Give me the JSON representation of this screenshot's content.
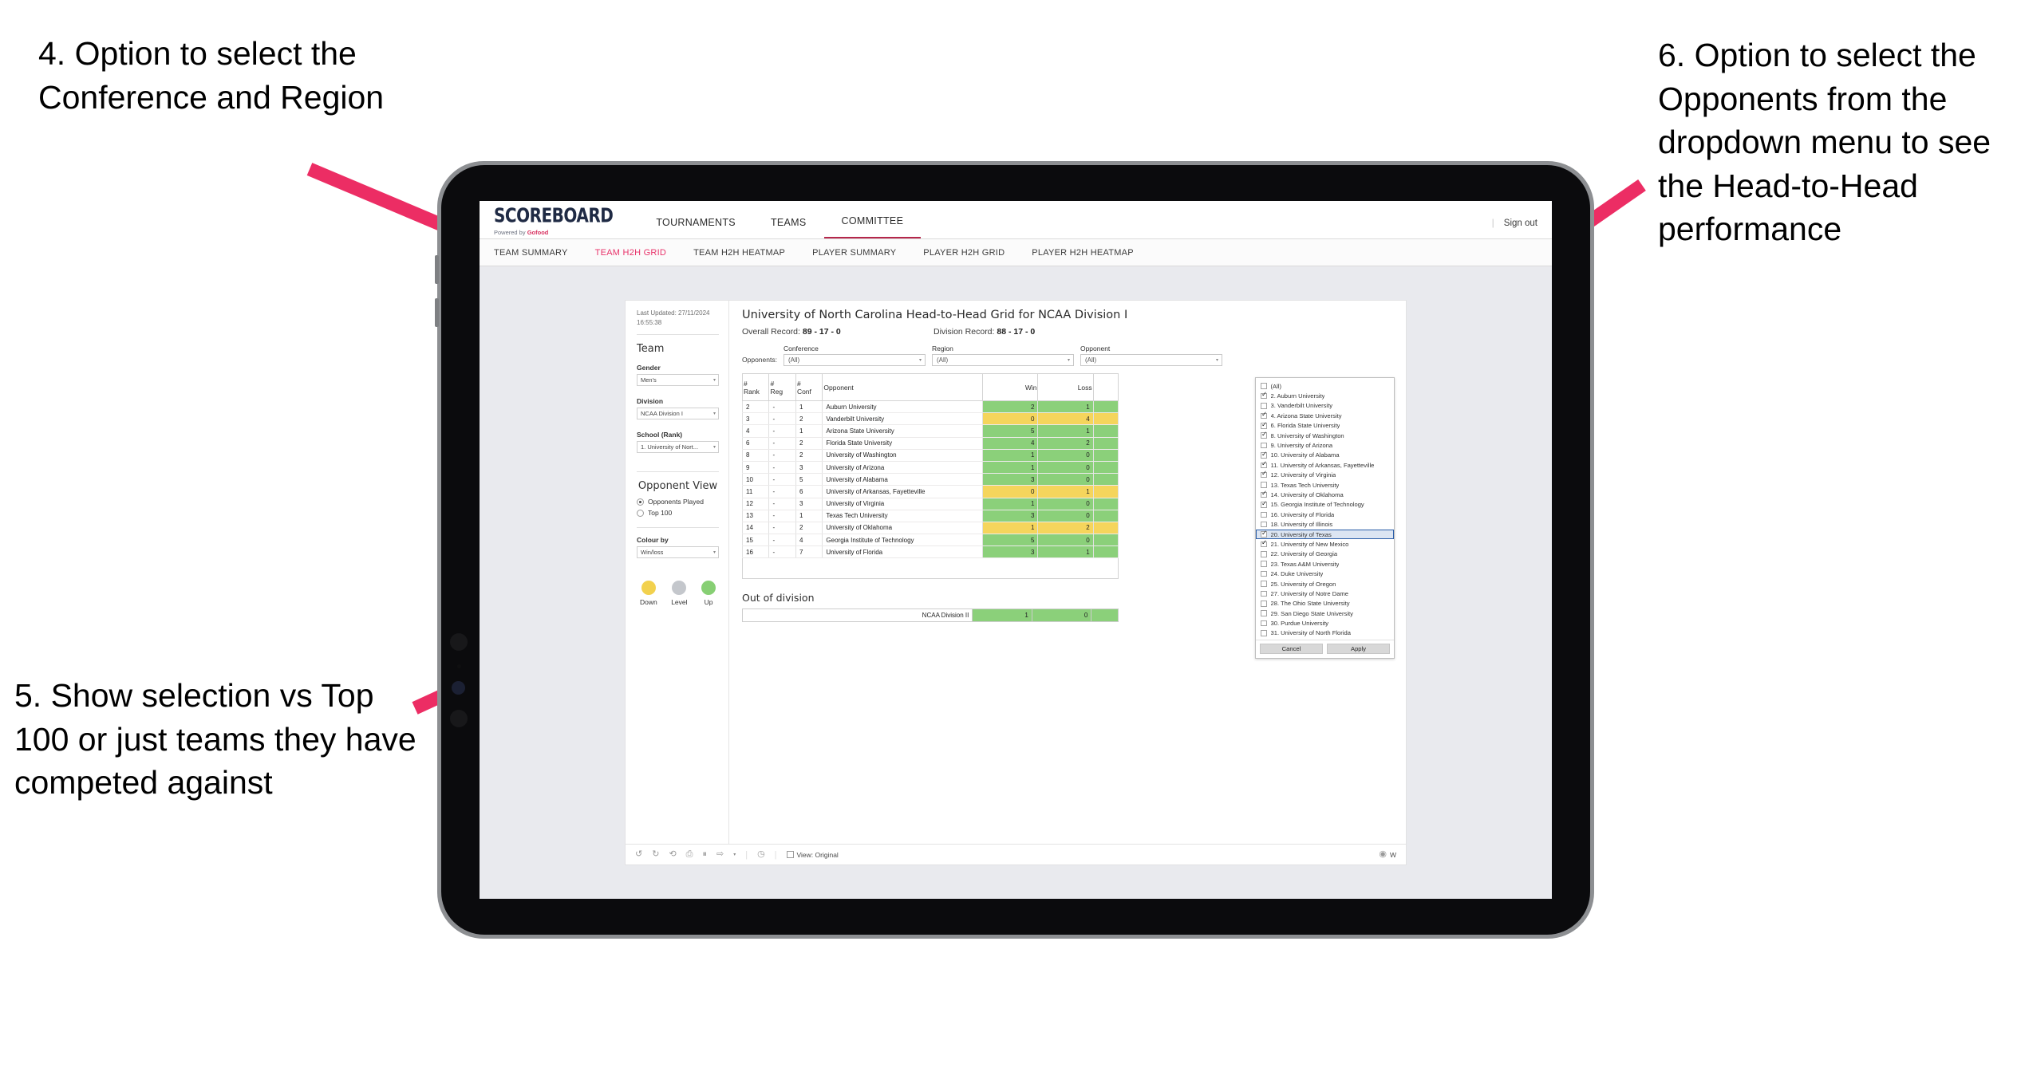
{
  "annotations": [
    {
      "id": "a4",
      "text": "4. Option to select the Conference and Region"
    },
    {
      "id": "a5",
      "text": "5. Show selection vs Top 100 or just teams they have competed against"
    },
    {
      "id": "a6",
      "text": "6. Option to select the Opponents from the dropdown menu to see the Head-to-Head performance"
    }
  ],
  "app": {
    "logo": {
      "main": "SCOREBOARD",
      "sub_prefix": "Powered by ",
      "sub_brand": "Gofood"
    },
    "topnav": [
      {
        "label": "TOURNAMENTS",
        "active": false
      },
      {
        "label": "TEAMS",
        "active": false
      },
      {
        "label": "COMMITTEE",
        "active": true
      }
    ],
    "signout": "Sign out",
    "divider": "|",
    "subnav": [
      {
        "label": "TEAM SUMMARY",
        "active": false
      },
      {
        "label": "TEAM H2H GRID",
        "active": true
      },
      {
        "label": "TEAM H2H HEATMAP",
        "active": false
      },
      {
        "label": "PLAYER SUMMARY",
        "active": false
      },
      {
        "label": "PLAYER H2H GRID",
        "active": false
      },
      {
        "label": "PLAYER H2H HEATMAP",
        "active": false
      }
    ]
  },
  "sidebar": {
    "last_updated": "Last Updated: 27/11/2024 16:55:38",
    "team_heading": "Team",
    "fields": [
      {
        "label": "Gender",
        "value": "Men's"
      },
      {
        "label": "Division",
        "value": "NCAA Division I"
      },
      {
        "label": "School (Rank)",
        "value": "1. University of Nort..."
      }
    ],
    "opponent_view_heading": "Opponent View",
    "opponent_view_options": [
      {
        "label": "Opponents Played",
        "selected": true
      },
      {
        "label": "Top 100",
        "selected": false
      }
    ],
    "colour_by": {
      "label": "Colour by",
      "value": "Win/loss"
    },
    "legend": [
      {
        "label": "Down",
        "color": "#f2d14e"
      },
      {
        "label": "Level",
        "color": "#c4c7cc"
      },
      {
        "label": "Up",
        "color": "#87cf74"
      }
    ]
  },
  "main": {
    "title": "University of North Carolina Head-to-Head Grid for NCAA Division I",
    "overall_record_label": "Overall Record:",
    "overall_record_value": "89 - 17 - 0",
    "division_record_label": "Division Record:",
    "division_record_value": "88 - 17 - 0",
    "opponents_label": "Opponents:",
    "filters": [
      {
        "label": "Conference",
        "value": "(All)"
      },
      {
        "label": "Region",
        "value": "(All)"
      },
      {
        "label": "Opponent",
        "value": "(All)"
      }
    ],
    "table": {
      "headers": [
        "# Rank",
        "# Reg",
        "# Conf",
        "Opponent",
        "Win",
        "Loss"
      ],
      "header_lines": [
        [
          "#",
          "Rank"
        ],
        [
          "#",
          "Reg"
        ],
        [
          "#",
          "Conf"
        ],
        [
          "Opponent"
        ],
        [
          "Win"
        ],
        [
          "Loss"
        ]
      ],
      "rows": [
        {
          "rank": "2",
          "reg": "-",
          "conf": "1",
          "opponent": "Auburn University",
          "win": "2",
          "loss": "1",
          "state": "up"
        },
        {
          "rank": "3",
          "reg": "-",
          "conf": "2",
          "opponent": "Vanderbilt University",
          "win": "0",
          "loss": "4",
          "state": "down"
        },
        {
          "rank": "4",
          "reg": "-",
          "conf": "1",
          "opponent": "Arizona State University",
          "win": "5",
          "loss": "1",
          "state": "up"
        },
        {
          "rank": "6",
          "reg": "-",
          "conf": "2",
          "opponent": "Florida State University",
          "win": "4",
          "loss": "2",
          "state": "up"
        },
        {
          "rank": "8",
          "reg": "-",
          "conf": "2",
          "opponent": "University of Washington",
          "win": "1",
          "loss": "0",
          "state": "up"
        },
        {
          "rank": "9",
          "reg": "-",
          "conf": "3",
          "opponent": "University of Arizona",
          "win": "1",
          "loss": "0",
          "state": "up"
        },
        {
          "rank": "10",
          "reg": "-",
          "conf": "5",
          "opponent": "University of Alabama",
          "win": "3",
          "loss": "0",
          "state": "up"
        },
        {
          "rank": "11",
          "reg": "-",
          "conf": "6",
          "opponent": "University of Arkansas, Fayetteville",
          "win": "0",
          "loss": "1",
          "state": "down"
        },
        {
          "rank": "12",
          "reg": "-",
          "conf": "3",
          "opponent": "University of Virginia",
          "win": "1",
          "loss": "0",
          "state": "up"
        },
        {
          "rank": "13",
          "reg": "-",
          "conf": "1",
          "opponent": "Texas Tech University",
          "win": "3",
          "loss": "0",
          "state": "up"
        },
        {
          "rank": "14",
          "reg": "-",
          "conf": "2",
          "opponent": "University of Oklahoma",
          "win": "1",
          "loss": "2",
          "state": "down"
        },
        {
          "rank": "15",
          "reg": "-",
          "conf": "4",
          "opponent": "Georgia Institute of Technology",
          "win": "5",
          "loss": "0",
          "state": "up"
        },
        {
          "rank": "16",
          "reg": "-",
          "conf": "7",
          "opponent": "University of Florida",
          "win": "3",
          "loss": "1",
          "state": "up"
        }
      ]
    },
    "out_of_division": {
      "title": "Out of division",
      "rows": [
        {
          "name": "NCAA Division II",
          "win": "1",
          "loss": "0",
          "state": "up"
        }
      ]
    }
  },
  "dropdown": {
    "items": [
      {
        "label": "(All)",
        "checked": false,
        "selected": false
      },
      {
        "label": "2. Auburn University",
        "checked": true,
        "selected": false
      },
      {
        "label": "3. Vanderbilt University",
        "checked": false,
        "selected": false
      },
      {
        "label": "4. Arizona State University",
        "checked": true,
        "selected": false
      },
      {
        "label": "6. Florida State University",
        "checked": true,
        "selected": false
      },
      {
        "label": "8. University of Washington",
        "checked": true,
        "selected": false
      },
      {
        "label": "9. University of Arizona",
        "checked": false,
        "selected": false
      },
      {
        "label": "10. University of Alabama",
        "checked": true,
        "selected": false
      },
      {
        "label": "11. University of Arkansas, Fayetteville",
        "checked": true,
        "selected": false
      },
      {
        "label": "12. University of Virginia",
        "checked": true,
        "selected": false
      },
      {
        "label": "13. Texas Tech University",
        "checked": false,
        "selected": false
      },
      {
        "label": "14. University of Oklahoma",
        "checked": true,
        "selected": false
      },
      {
        "label": "15. Georgia Institute of Technology",
        "checked": true,
        "selected": false
      },
      {
        "label": "16. University of Florida",
        "checked": false,
        "selected": false
      },
      {
        "label": "18. University of Illinois",
        "checked": false,
        "selected": false
      },
      {
        "label": "20. University of Texas",
        "checked": true,
        "selected": true
      },
      {
        "label": "21. University of New Mexico",
        "checked": true,
        "selected": false
      },
      {
        "label": "22. University of Georgia",
        "checked": false,
        "selected": false
      },
      {
        "label": "23. Texas A&M University",
        "checked": false,
        "selected": false
      },
      {
        "label": "24. Duke University",
        "checked": false,
        "selected": false
      },
      {
        "label": "25. University of Oregon",
        "checked": false,
        "selected": false
      },
      {
        "label": "27. University of Notre Dame",
        "checked": false,
        "selected": false
      },
      {
        "label": "28. The Ohio State University",
        "checked": false,
        "selected": false
      },
      {
        "label": "29. San Diego State University",
        "checked": false,
        "selected": false
      },
      {
        "label": "30. Purdue University",
        "checked": false,
        "selected": false
      },
      {
        "label": "31. University of North Florida",
        "checked": false,
        "selected": false
      }
    ],
    "cancel": "Cancel",
    "apply": "Apply"
  },
  "toolbar": {
    "view_label": "View: Original",
    "watch_label": "W"
  },
  "colors": {
    "accent_pink": "#e8336a",
    "arrow_pink": "#ec2d64",
    "nav_underline": "#b5274b",
    "win_green": "#8bd07a",
    "loss_yellow": "#f5d55c",
    "selected_blue": "#2a5da8"
  }
}
